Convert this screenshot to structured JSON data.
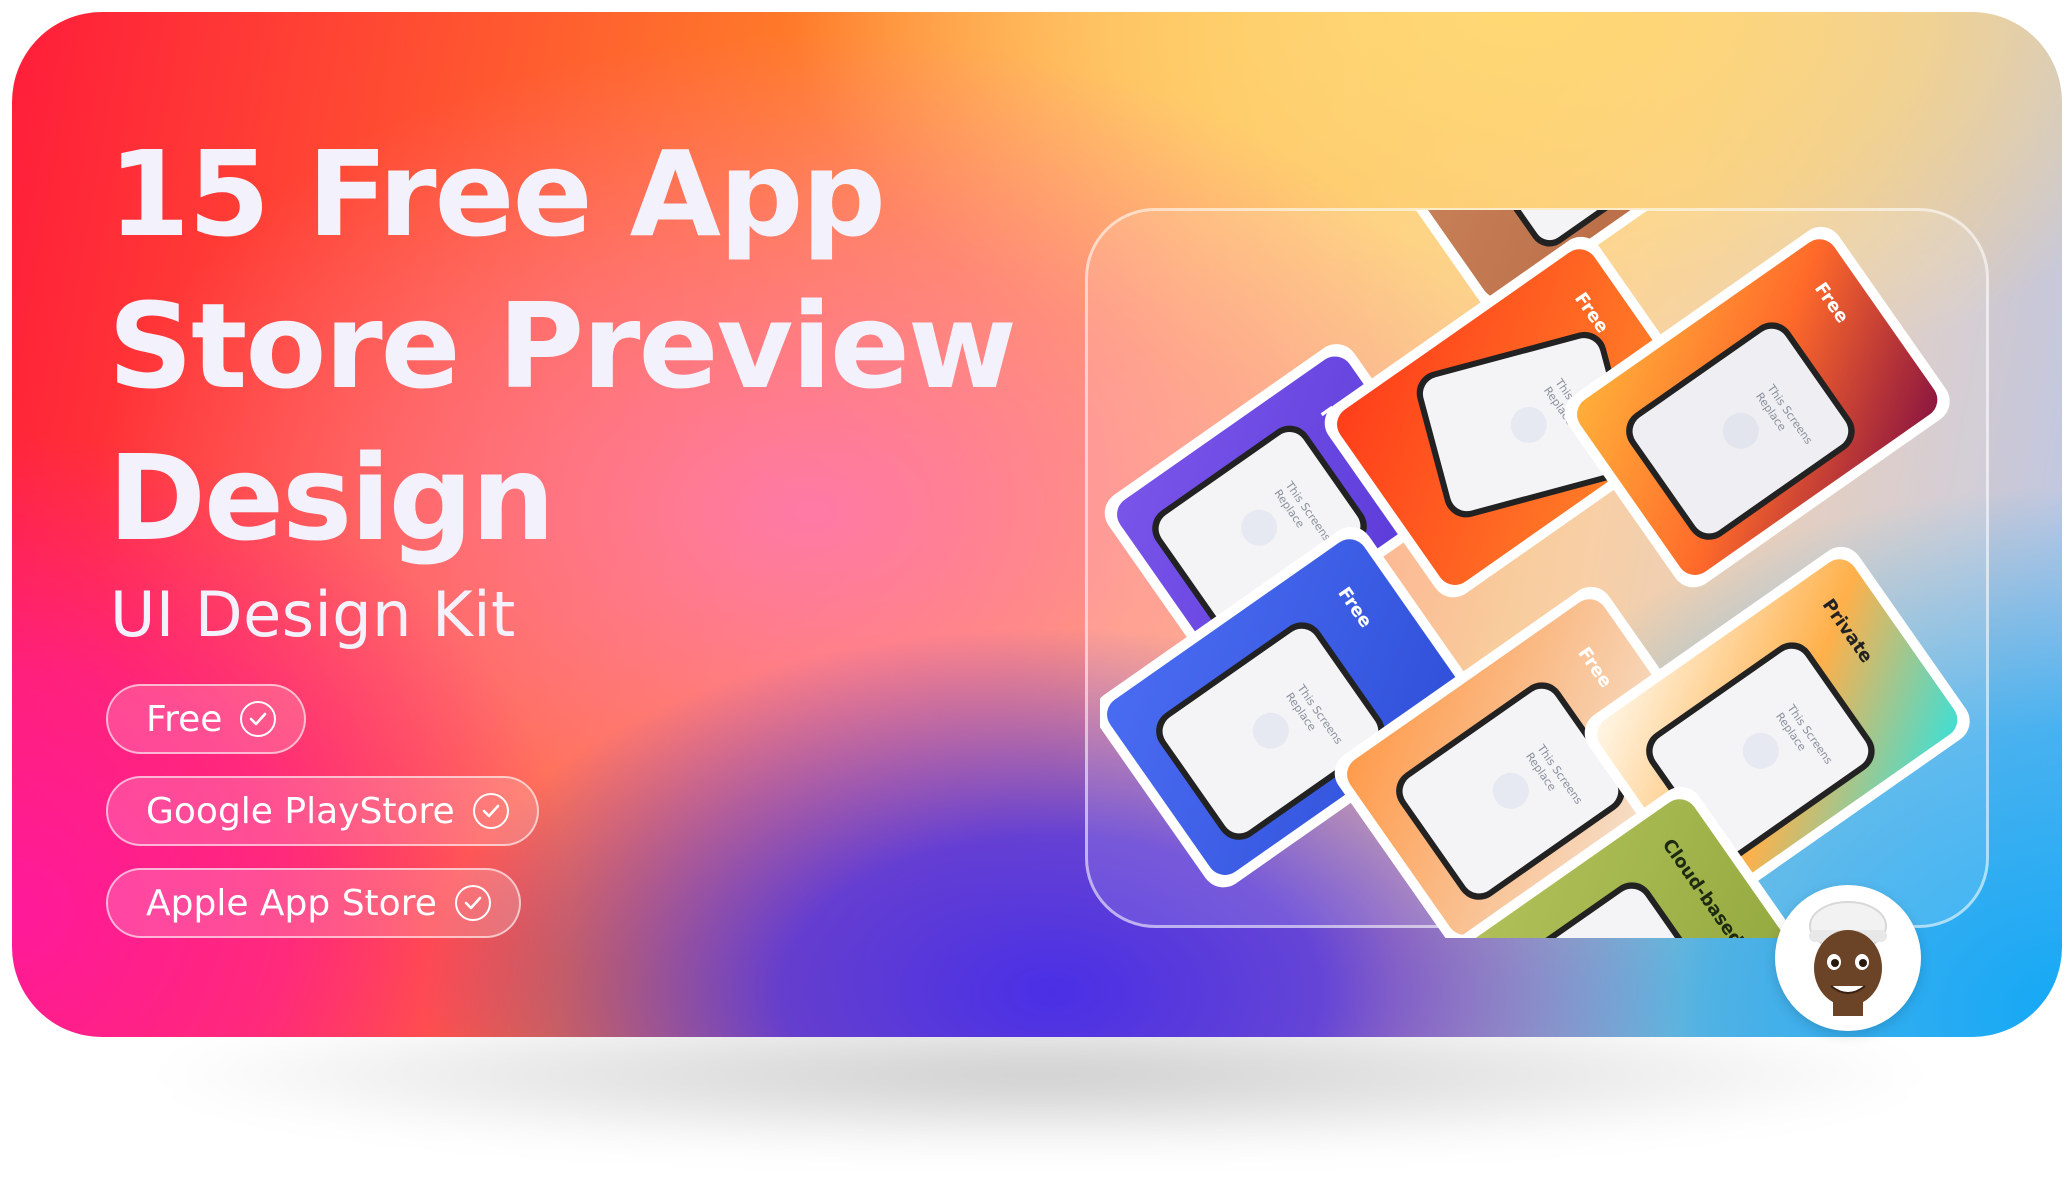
{
  "hero": {
    "title": "15 Free App\nStore Preview\nDesign",
    "subtitle": "UI Design Kit"
  },
  "tags": [
    {
      "label": "Free",
      "icon": "check-circle-icon"
    },
    {
      "label": "Google PlayStore",
      "icon": "check-circle-icon"
    },
    {
      "label": "Apple App Store",
      "icon": "check-circle-icon"
    }
  ],
  "preview": {
    "phone_labels": [
      "Free",
      "Free",
      "Free",
      "Free",
      "Free",
      "Private",
      "Cloud-based"
    ],
    "screen_placeholder_line1": "Replace",
    "screen_placeholder_line2": "This Screens"
  },
  "avatar": {
    "icon": "memoji-avatar-icon"
  },
  "colors": {
    "purple_card": "#6b46e0",
    "orange_red_card": "#ff4d1f",
    "blue_card": "#3a5ee8",
    "amber_card": "#ff9a2a",
    "orange_card": "#ff8a3d",
    "dark_red_card": "#b0203d",
    "brown_card": "#c47a52",
    "green_card": "#a6b84e"
  }
}
